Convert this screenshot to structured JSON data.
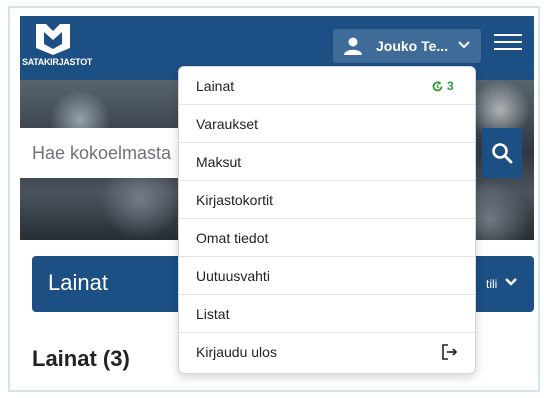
{
  "header": {
    "logo_text": "SATAKIRJASTOT",
    "user_name": "Jouko Te...",
    "brand_color": "#1c4f84"
  },
  "search": {
    "placeholder": "Hae kokoelmasta"
  },
  "dropdown": {
    "items": [
      {
        "label": "Lainat",
        "badge": "3",
        "badge_icon": "renew-icon",
        "badge_color": "#2e9e38"
      },
      {
        "label": "Varaukset"
      },
      {
        "label": "Maksut"
      },
      {
        "label": "Kirjastokortit"
      },
      {
        "label": "Omat tiedot"
      },
      {
        "label": "Uutuusvahti"
      },
      {
        "label": "Listat"
      },
      {
        "label": "Kirjaudu ulos",
        "icon": "logout-icon"
      }
    ]
  },
  "section": {
    "band_title": "Lainat",
    "band_right_text": "tili",
    "heading": "Lainat (3)"
  }
}
